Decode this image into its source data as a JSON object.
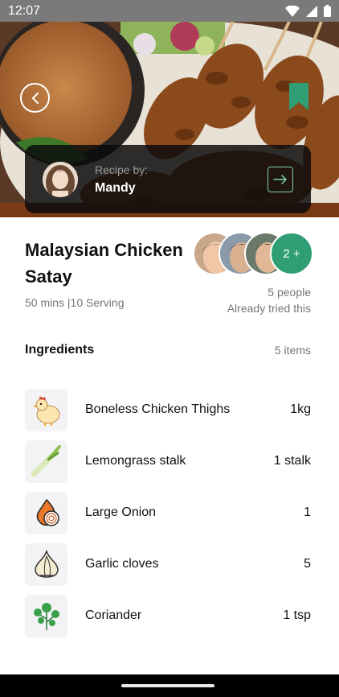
{
  "status": {
    "time": "12:07"
  },
  "recipe": {
    "by_label": "Recipe by:",
    "author": "Mandy",
    "title": "Malaysian Chicken Satay",
    "meta": "50 mins |10 Serving"
  },
  "tried": {
    "more_badge": "2 +",
    "people": "5 people",
    "text": "Already tried this"
  },
  "ingredients": {
    "heading": "Ingredients",
    "count": "5 items",
    "items": [
      {
        "name": "Boneless Chicken Thighs",
        "qty": "1kg",
        "icon": "chicken-icon"
      },
      {
        "name": "Lemongrass stalk",
        "qty": "1 stalk",
        "icon": "lemongrass-icon"
      },
      {
        "name": "Large Onion",
        "qty": "1",
        "icon": "onion-icon"
      },
      {
        "name": "Garlic cloves",
        "qty": "5",
        "icon": "garlic-icon"
      },
      {
        "name": "Coriander",
        "qty": "1 tsp",
        "icon": "coriander-icon"
      }
    ]
  },
  "colors": {
    "accent": "#2f9e74",
    "bookmark": "#2f9e74",
    "card": "#0c0c0c"
  }
}
